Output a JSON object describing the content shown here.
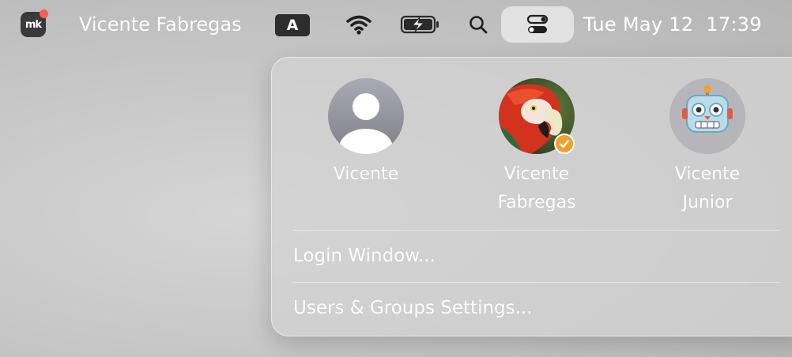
{
  "menubar": {
    "app_icon": "mk-icon",
    "app_icon_text": "mk",
    "user_name": "Vicente Fabregas",
    "input_source": "A",
    "wifi_icon": "wifi-icon",
    "battery_icon": "battery-charging-icon",
    "search_icon": "search-icon",
    "control_center_icon": "control-center-icon",
    "clock": "Tue May 12  17:39"
  },
  "panel": {
    "users": [
      {
        "name": "Vicente",
        "avatar": "generic-person",
        "selected": false
      },
      {
        "name": "Vicente\nFabregas",
        "avatar": "parrot-photo",
        "selected": true
      },
      {
        "name": "Vicente\nJunior",
        "avatar": "robot-emoji",
        "selected": false
      }
    ],
    "login_window": "Login Window...",
    "users_groups_settings": "Users & Groups Settings..."
  },
  "colors": {
    "selected_badge": "#f0a030",
    "menubar_text": "#ffffff"
  }
}
